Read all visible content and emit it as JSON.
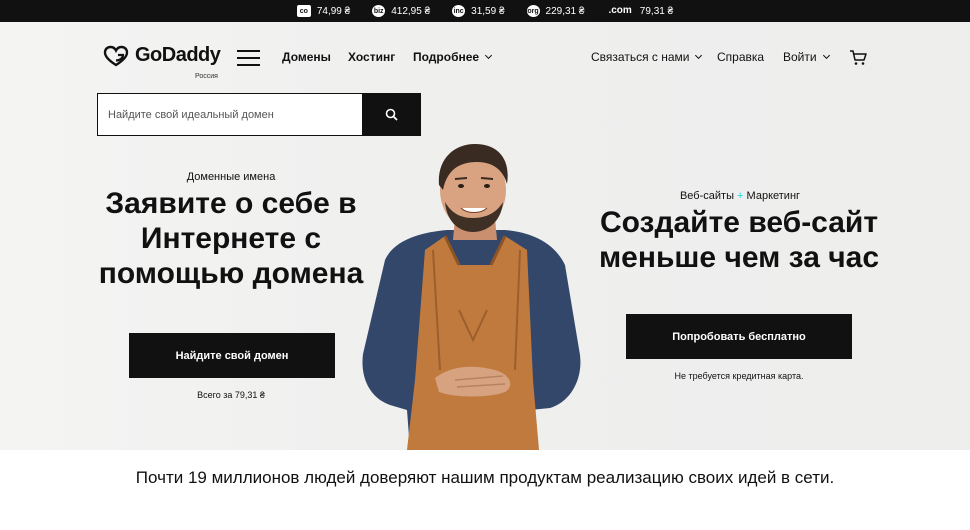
{
  "domain_prices": [
    {
      "badge": "co",
      "price": "74,99 ₴",
      "icon": "co-badge-icon"
    },
    {
      "badge": "biz",
      "price": "412,95 ₴",
      "icon": "biz-badge-icon"
    },
    {
      "badge": "inc",
      "price": "31,59 ₴",
      "icon": "inc-badge-icon"
    },
    {
      "badge": "org",
      "price": "229,31 ₴",
      "icon": "org-badge-icon"
    },
    {
      "badge": ".com",
      "price": "79,31 ₴",
      "icon": "com-badge-icon"
    }
  ],
  "header": {
    "logo_text": "GoDaddy",
    "logo_sub": "Россия",
    "nav": {
      "domains": "Домены",
      "hosting": "Хостинг",
      "more": "Подробнее",
      "contact": "Связаться с нами",
      "help": "Справка",
      "login": "Войти"
    }
  },
  "search": {
    "placeholder": "Найдите свой идеальный домен"
  },
  "left_promo": {
    "eyebrow": "Доменные имена",
    "headline_1": "Заявите о себе в",
    "headline_2": "Интернете с",
    "headline_3": "помощью домена",
    "cta": "Найдите свой домен",
    "fine": "Всего за 79,31 ₴"
  },
  "right_promo": {
    "eyebrow_a": "Веб-сайты",
    "eyebrow_plus": "+",
    "eyebrow_b": "Маркетинг",
    "headline_1": "Создайте веб-сайт",
    "headline_2": "меньше чем за час",
    "cta": "Попробовать бесплатно",
    "fine": "Не требуется кредитная карта."
  },
  "trust": {
    "text": "Почти 19 миллионов людей доверяют нашим продуктам реализацию своих идей в сети."
  },
  "colors": {
    "accent_plus": "#1bdbdb",
    "dark": "#111111",
    "hero_bg": "#efefee"
  }
}
